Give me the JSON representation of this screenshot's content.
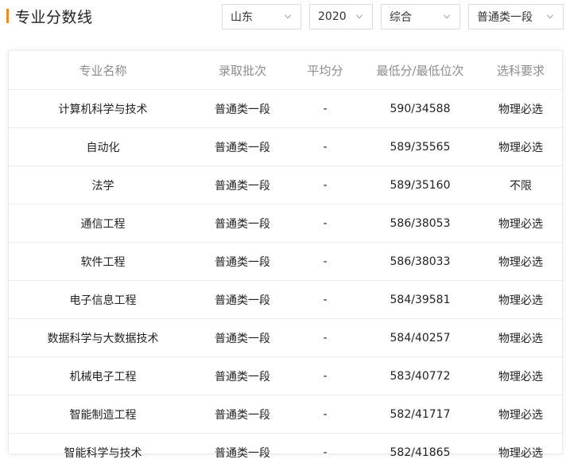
{
  "page": {
    "title": "专业分数线"
  },
  "filters": {
    "province": "山东",
    "year": "2020",
    "subject": "综合",
    "batch": "普通类一段"
  },
  "table": {
    "headers": [
      "专业名称",
      "录取批次",
      "平均分",
      "最低分/最低位次",
      "选科要求"
    ],
    "rows": [
      [
        "计算机科学与技术",
        "普通类一段",
        "-",
        "590/34588",
        "物理必选"
      ],
      [
        "自动化",
        "普通类一段",
        "-",
        "589/35565",
        "物理必选"
      ],
      [
        "法学",
        "普通类一段",
        "-",
        "589/35160",
        "不限"
      ],
      [
        "通信工程",
        "普通类一段",
        "-",
        "586/38053",
        "物理必选"
      ],
      [
        "软件工程",
        "普通类一段",
        "-",
        "586/38033",
        "物理必选"
      ],
      [
        "电子信息工程",
        "普通类一段",
        "-",
        "584/39581",
        "物理必选"
      ],
      [
        "数据科学与大数据技术",
        "普通类一段",
        "-",
        "584/40257",
        "物理必选"
      ],
      [
        "机械电子工程",
        "普通类一段",
        "-",
        "583/40772",
        "物理必选"
      ],
      [
        "智能制造工程",
        "普通类一段",
        "-",
        "582/41717",
        "物理必选"
      ],
      [
        "智能科学与技术",
        "普通类一段",
        "-",
        "582/41865",
        "物理必选"
      ]
    ]
  },
  "colors": {
    "accent": "#f08a24",
    "header_text": "#8c8c8c",
    "border": "#ececec"
  },
  "icons": {
    "dropdown": "chevron-down-icon"
  }
}
